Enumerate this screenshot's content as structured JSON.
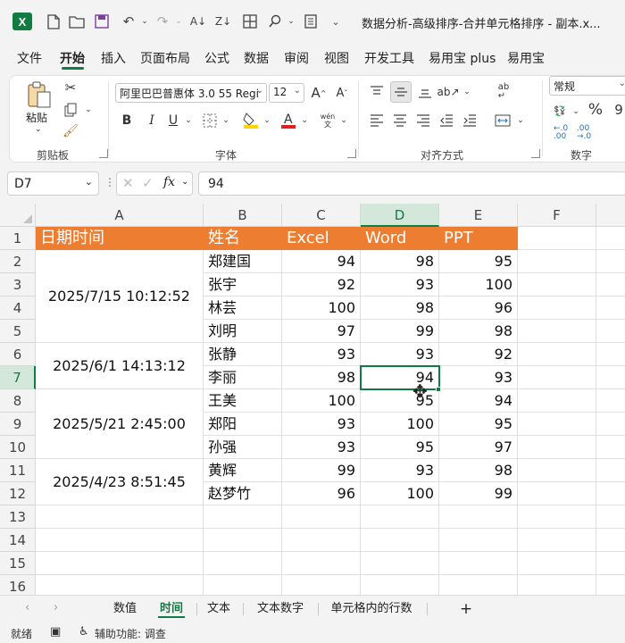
{
  "app": {
    "title": "数据分析-高级排序-合并单元格排序 - 副本.x...",
    "logo_letter": "X",
    "accent": "#107c41",
    "header_fill": "#ed7d31"
  },
  "menu": {
    "items": [
      "文件",
      "开始",
      "插入",
      "页面布局",
      "公式",
      "数据",
      "审阅",
      "视图",
      "开发工具",
      "易用宝 plus",
      "易用宝"
    ],
    "active": "开始"
  },
  "ribbon": {
    "clipboard": {
      "label": "剪贴板",
      "paste": "粘贴"
    },
    "font": {
      "label": "字体",
      "font_name": "阿里巴巴普惠体 3.0 55 Regi",
      "font_size": "12",
      "bold": "B",
      "italic": "I",
      "underline": "U",
      "phonetic": "wén 文"
    },
    "alignment": {
      "label": "对齐方式"
    },
    "number": {
      "label": "数字",
      "format": "常规"
    }
  },
  "formula_bar": {
    "name_box": "D7",
    "fx": "fx",
    "content": "94"
  },
  "columns": [
    "A",
    "B",
    "C",
    "D",
    "E",
    "F"
  ],
  "rows": [
    "1",
    "2",
    "3",
    "4",
    "5",
    "6",
    "7",
    "8",
    "9",
    "10",
    "11",
    "12",
    "13",
    "14",
    "15",
    "16"
  ],
  "table": {
    "headers": [
      "日期时间",
      "姓名",
      "Excel",
      "Word",
      "PPT"
    ],
    "dates": [
      "2025/7/15 10:12:52",
      "2025/6/1 14:13:12",
      "2025/5/21 2:45:00",
      "2025/4/23 8:51:45"
    ],
    "records": [
      {
        "name": "郑建国",
        "excel": "94",
        "word": "98",
        "ppt": "95"
      },
      {
        "name": "张宇",
        "excel": "92",
        "word": "93",
        "ppt": "100"
      },
      {
        "name": "林芸",
        "excel": "100",
        "word": "98",
        "ppt": "96"
      },
      {
        "name": "刘明",
        "excel": "97",
        "word": "99",
        "ppt": "98"
      },
      {
        "name": "张静",
        "excel": "93",
        "word": "93",
        "ppt": "92"
      },
      {
        "name": "李丽",
        "excel": "98",
        "word": "94",
        "ppt": "93"
      },
      {
        "name": "王美",
        "excel": "100",
        "word": "95",
        "ppt": "94"
      },
      {
        "name": "郑阳",
        "excel": "93",
        "word": "100",
        "ppt": "95"
      },
      {
        "name": "孙强",
        "excel": "93",
        "word": "95",
        "ppt": "97"
      },
      {
        "name": "黄辉",
        "excel": "99",
        "word": "93",
        "ppt": "98"
      },
      {
        "name": "赵梦竹",
        "excel": "96",
        "word": "100",
        "ppt": "99"
      }
    ]
  },
  "sheets": {
    "tabs": [
      "数值",
      "时间",
      "文本",
      "文本数字",
      "单元格内的行数"
    ],
    "active": "时间",
    "add": "+"
  },
  "status": {
    "ready": "就绪",
    "accessibility": "辅助功能: 调查"
  }
}
